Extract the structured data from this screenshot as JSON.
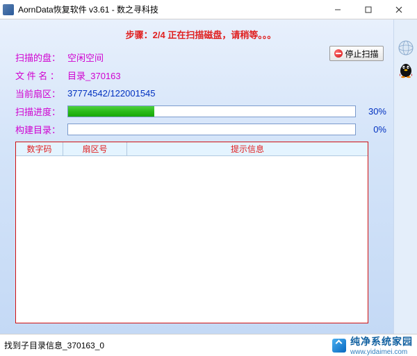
{
  "window": {
    "title": "AornData恢复软件 v3.61  - 数之寻科技"
  },
  "step": {
    "text": "步骤：2/4 正在扫描磁盘，请稍等。。。"
  },
  "stopButton": {
    "label": "停止扫描"
  },
  "info": {
    "diskLabel": "扫描的盘：",
    "diskValue": "空闲空间",
    "fileLabel": "文 件 名 ：",
    "fileValue": "目录_370163",
    "sectorLabel": "当前扇区：",
    "sectorValue": "37774542/122001545"
  },
  "progress": {
    "scanLabel": "扫描进度：",
    "scanPct": "30%",
    "scanWidth": "30%",
    "buildLabel": "构建目录：",
    "buildPct": "0%",
    "buildWidth": "0%"
  },
  "grid": {
    "headers": {
      "code": "数字码",
      "sector": "扇区号",
      "hint": "提示信息"
    }
  },
  "status": {
    "text": "找到子目录信息_370163_0"
  },
  "footer": {
    "brand": "纯净系统家园",
    "url": "www.yidaimei.com"
  }
}
